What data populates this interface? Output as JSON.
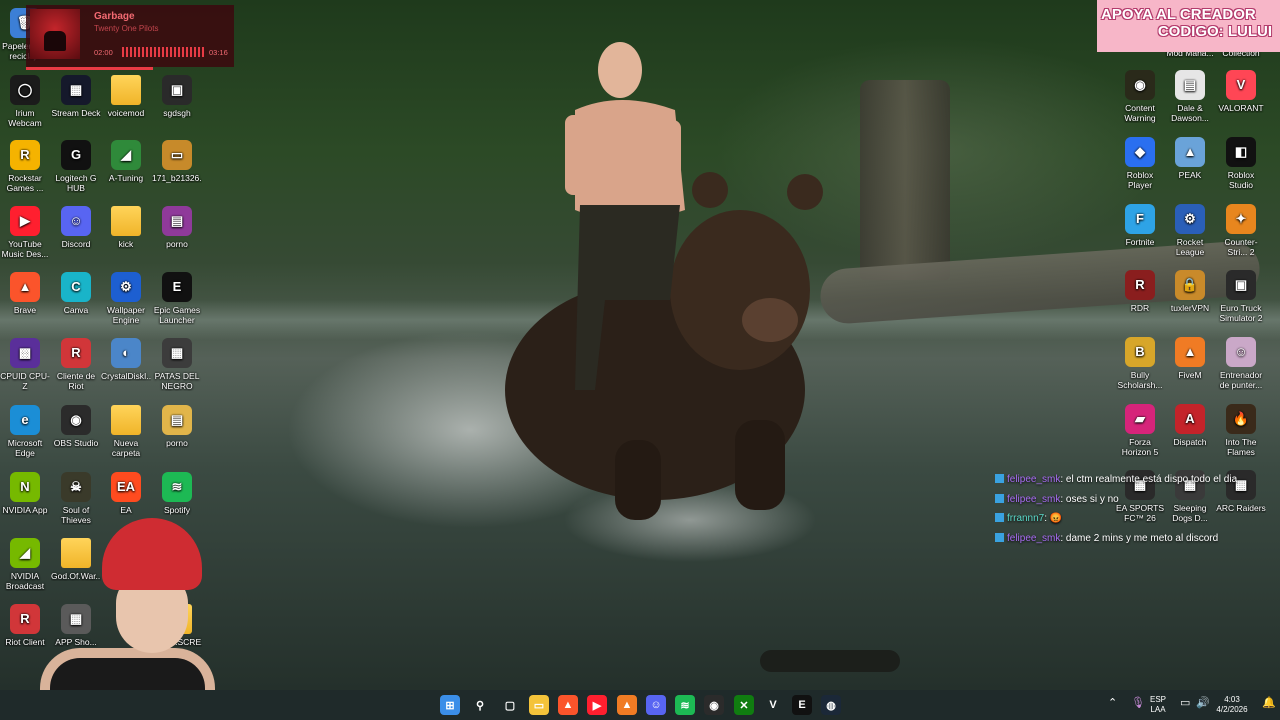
{
  "desktop": {
    "left_icons": [
      {
        "label": "Papelera de reciclaje",
        "bg": "#3c7fd6",
        "glyph": "🗑"
      },
      {
        "label": "Irium Webcam",
        "bg": "#1b1b1b",
        "glyph": "◯"
      },
      {
        "label": "Stream Deck",
        "bg": "#15192b",
        "glyph": "▦"
      },
      {
        "label": "voicemod",
        "bg": "",
        "glyph": ""
      },
      {
        "label": "sgdsgh",
        "bg": "#2a2a2a",
        "glyph": "▣"
      },
      {
        "label": "Rockstar Games ...",
        "bg": "#f5b300",
        "glyph": "R"
      },
      {
        "label": "Logitech G HUB",
        "bg": "#111111",
        "glyph": "G"
      },
      {
        "label": "A-Tuning",
        "bg": "#2f8a3a",
        "glyph": "◢"
      },
      {
        "label": "171_b21326...",
        "bg": "#c78a2a",
        "glyph": "▭"
      },
      {
        "label": "YouTube Music Des...",
        "bg": "#ff1f2f",
        "glyph": "▶"
      },
      {
        "label": "Discord",
        "bg": "#5865f2",
        "glyph": "☺"
      },
      {
        "label": "kick",
        "bg": "",
        "glyph": ""
      },
      {
        "label": "porno",
        "bg": "#8f3a9a",
        "glyph": "▤"
      },
      {
        "label": "Brave",
        "bg": "#fb542b",
        "glyph": "▲"
      },
      {
        "label": "Canva",
        "bg": "#19b4c9",
        "glyph": "C"
      },
      {
        "label": "Wallpaper Engine",
        "bg": "#1d5fd1",
        "glyph": "⚙"
      },
      {
        "label": "Epic Games Launcher",
        "bg": "#111111",
        "glyph": "E"
      },
      {
        "label": "CPUID CPU-Z",
        "bg": "#5a2f9a",
        "glyph": "▩"
      },
      {
        "label": "Cliente de Riot",
        "bg": "#d13639",
        "glyph": "R"
      },
      {
        "label": "CrystalDiskI...",
        "bg": "#4b86c9",
        "glyph": "◐"
      },
      {
        "label": "PATAS DEL NEGRO",
        "bg": "#3c3c3c",
        "glyph": "▦"
      },
      {
        "label": "Microsoft Edge",
        "bg": "#1b8ed6",
        "glyph": "e"
      },
      {
        "label": "OBS Studio",
        "bg": "#2b2b2b",
        "glyph": "◉"
      },
      {
        "label": "Nueva carpeta",
        "bg": "",
        "glyph": ""
      },
      {
        "label": "porno",
        "bg": "#e1b54a",
        "glyph": "▤"
      },
      {
        "label": "NVIDIA App",
        "bg": "#76b900",
        "glyph": "N"
      },
      {
        "label": "Soul of Thieves",
        "bg": "#3a3a2a",
        "glyph": "☠"
      },
      {
        "label": "EA",
        "bg": "#ff4b1f",
        "glyph": "EA"
      },
      {
        "label": "Spotify",
        "bg": "#1db954",
        "glyph": "≋"
      },
      {
        "label": "NVIDIA Broadcast",
        "bg": "#76b900",
        "glyph": "◢"
      },
      {
        "label": "God.Of.War...",
        "bg": "",
        "glyph": ""
      },
      {
        "label": "Riot Client",
        "bg": "#d13639",
        "glyph": "R"
      },
      {
        "label": "APP Sho...",
        "bg": "#5a5a5a",
        "glyph": "▦"
      },
      {
        "label": "CONT.SCRE...",
        "bg": "",
        "glyph": ""
      }
    ],
    "right_icons": [
      {
        "label": "Mod Mana...",
        "bg": "#6b4a3a",
        "glyph": ""
      },
      {
        "label": "Collection",
        "bg": "#3a3a3a",
        "glyph": ""
      },
      {
        "label": "Content Warning",
        "bg": "#2a2a1a",
        "glyph": "◉"
      },
      {
        "label": "Dale & Dawson...",
        "bg": "#e6e6e6",
        "glyph": "▤"
      },
      {
        "label": "VALORANT",
        "bg": "#ff4655",
        "glyph": "V"
      },
      {
        "label": "Roblox Player",
        "bg": "#2a6ff0",
        "glyph": "◆"
      },
      {
        "label": "PEAK",
        "bg": "#6aa3d9",
        "glyph": "▲"
      },
      {
        "label": "Roblox Studio",
        "bg": "#111111",
        "glyph": "◧"
      },
      {
        "label": "Fortnite",
        "bg": "#2ea3e6",
        "glyph": "F"
      },
      {
        "label": "Rocket League",
        "bg": "#2a5fb8",
        "glyph": "⚙"
      },
      {
        "label": "Counter-Stri... 2",
        "bg": "#e8861e",
        "glyph": "✦"
      },
      {
        "label": "RDR",
        "bg": "#8a1e1e",
        "glyph": "R"
      },
      {
        "label": "tuxlerVPN",
        "bg": "#c98a2a",
        "glyph": "🔒"
      },
      {
        "label": "Euro Truck Simulator 2",
        "bg": "#2a2a2a",
        "glyph": "▣"
      },
      {
        "label": "Bully Scholarsh...",
        "bg": "#d7a62a",
        "glyph": "B"
      },
      {
        "label": "FiveM",
        "bg": "#f07b24",
        "glyph": "▲"
      },
      {
        "label": "Entrenador de punter...",
        "bg": "#caa8c8",
        "glyph": "☺"
      },
      {
        "label": "Forza Horizon 5",
        "bg": "#d6247a",
        "glyph": "▰"
      },
      {
        "label": "Dispatch",
        "bg": "#c4232a",
        "glyph": "A"
      },
      {
        "label": "Into The Flames",
        "bg": "#3a2a1a",
        "glyph": "🔥"
      },
      {
        "label": "EA SPORTS FC™ 26",
        "bg": "#2a2a2a",
        "glyph": "▦"
      },
      {
        "label": "Sleeping Dogs D...",
        "bg": "#3a3a3a",
        "glyph": "▦"
      },
      {
        "label": "ARC Raiders",
        "bg": "#2a2a2a",
        "glyph": "▦"
      }
    ]
  },
  "music_widget": {
    "title": "Garbage",
    "artist": "Twenty One Pilots",
    "time_elapsed": "02:00",
    "time_total": "03:16",
    "progress": 0.61,
    "accent": "#e83b45"
  },
  "banner": {
    "line1": "APOYA AL CREADOR",
    "line2": "CODIGO: LULUI",
    "bg": "#f7b6c8"
  },
  "chat": [
    {
      "user": "felipee_smk",
      "sep": ": ",
      "text": "el ctm realmente está dispo todo el dia"
    },
    {
      "user": "felipee_smk",
      "sep": ": ",
      "text": "oses si y no"
    },
    {
      "user": "frrannn7",
      "sep": ": ",
      "text": "😡"
    },
    {
      "user": "felipee_smk",
      "sep": ": ",
      "text": "dame 2 mins y me meto al discord"
    }
  ],
  "taskbar": {
    "apps": [
      {
        "name": "start",
        "bg": "#3b8ee8",
        "glyph": "⊞"
      },
      {
        "name": "search",
        "bg": "",
        "glyph": "⚲"
      },
      {
        "name": "task-view",
        "bg": "",
        "glyph": "▢"
      },
      {
        "name": "file-explorer",
        "bg": "#f4c33a",
        "glyph": "▭"
      },
      {
        "name": "brave",
        "bg": "#fb542b",
        "glyph": "▲"
      },
      {
        "name": "youtube-music",
        "bg": "#ff1f2f",
        "glyph": "▶"
      },
      {
        "name": "fivem",
        "bg": "#f07b24",
        "glyph": "▲"
      },
      {
        "name": "discord",
        "bg": "#5865f2",
        "glyph": "☺"
      },
      {
        "name": "spotify",
        "bg": "#1db954",
        "glyph": "≋"
      },
      {
        "name": "obs",
        "bg": "#2b2b2b",
        "glyph": "◉"
      },
      {
        "name": "xbox",
        "bg": "#107c10",
        "glyph": "✕"
      },
      {
        "name": "valorant",
        "bg": "",
        "glyph": "V"
      },
      {
        "name": "epic-games",
        "bg": "#111111",
        "glyph": "E"
      },
      {
        "name": "steam",
        "bg": "#1b2838",
        "glyph": "◍"
      }
    ],
    "lang_line1": "ESP",
    "lang_line2": "LAA",
    "time": "4:03",
    "date": "4/2/2026"
  }
}
